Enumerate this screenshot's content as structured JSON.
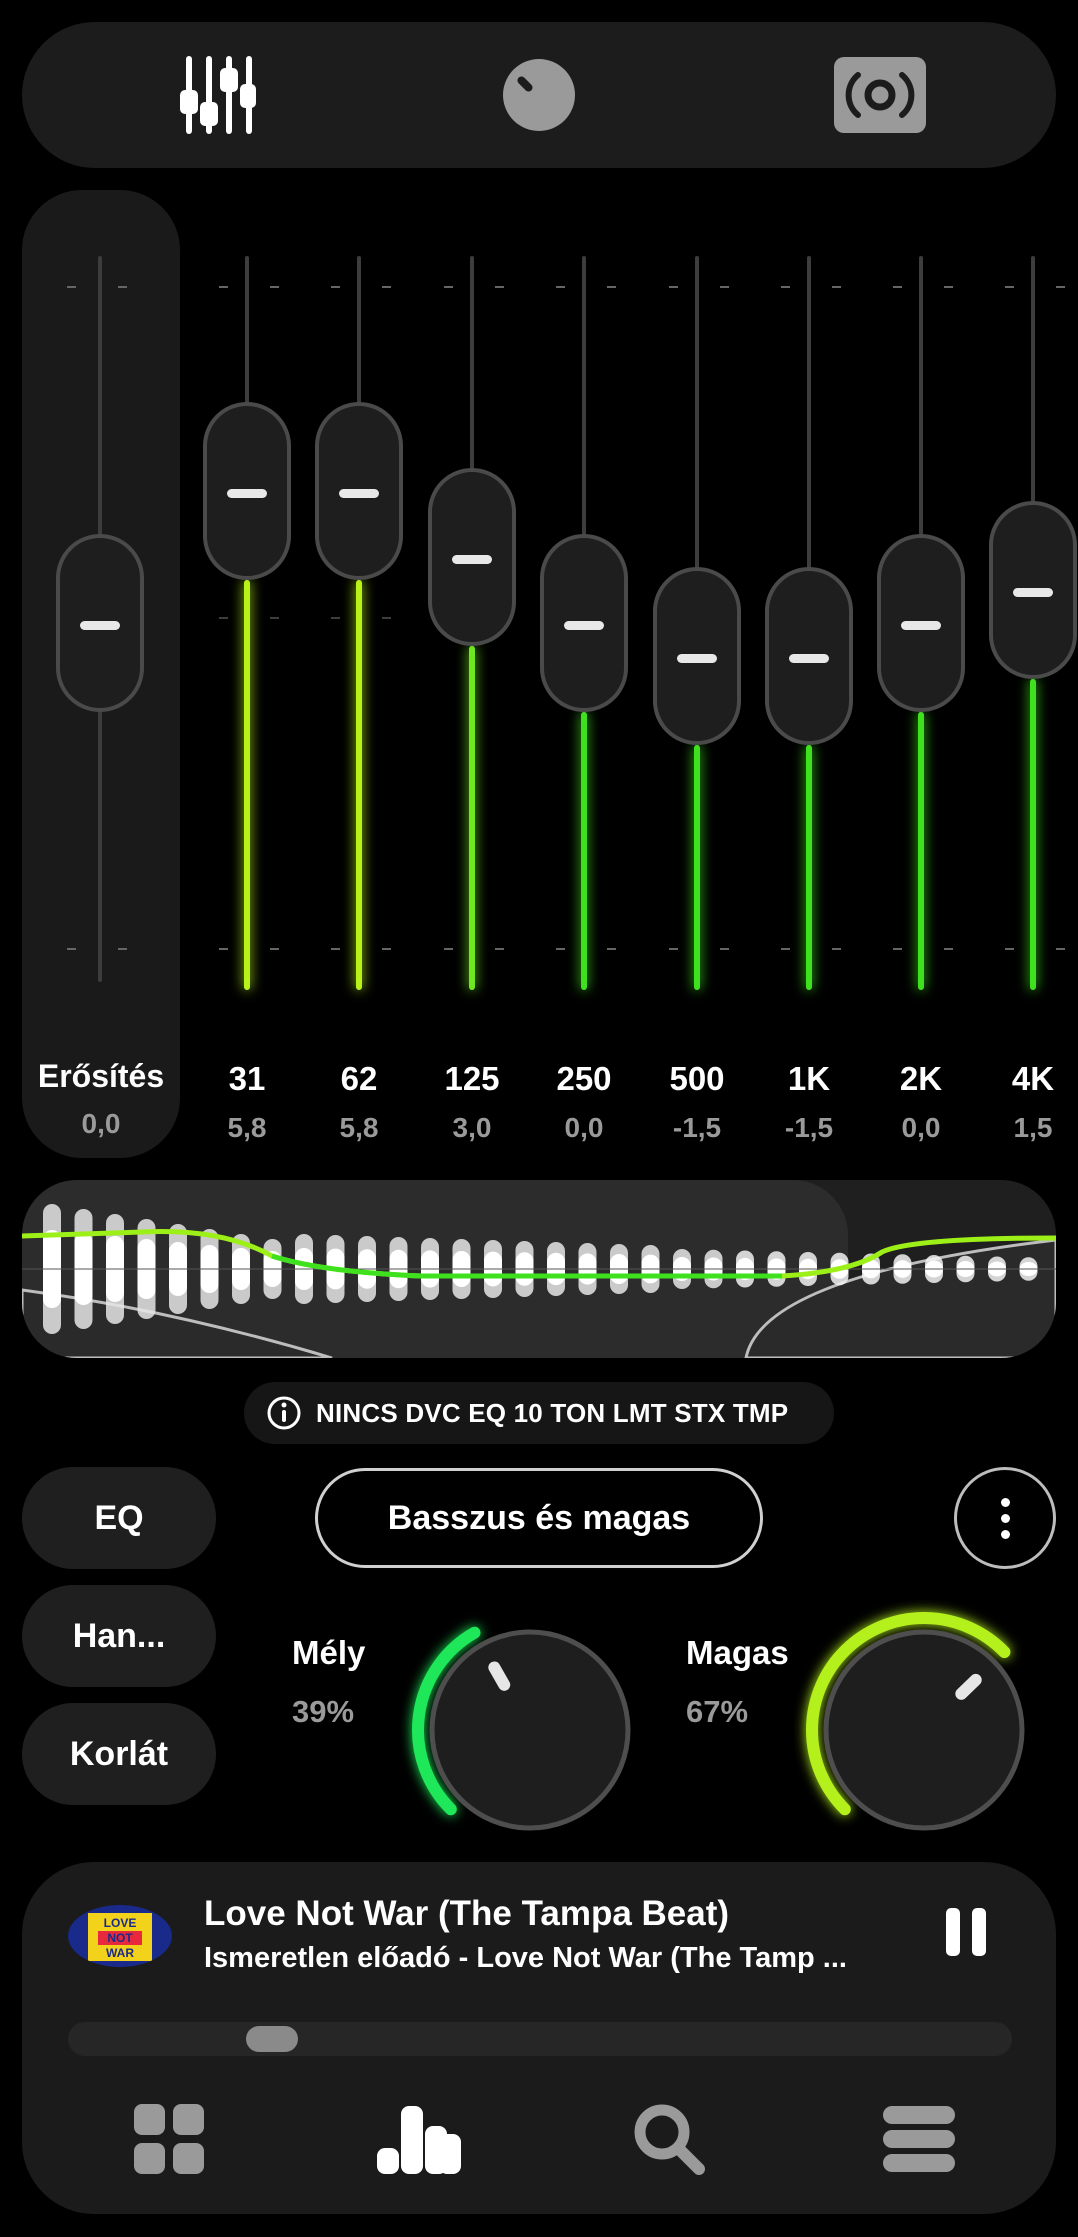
{
  "top_tabs": [
    {
      "name": "equalizer-tab",
      "icon": "equalizer-sliders-icon",
      "active": true
    },
    {
      "name": "volume-tab",
      "icon": "volume-knob-icon",
      "active": false
    },
    {
      "name": "speaker-tab",
      "icon": "speaker-icon",
      "active": false
    }
  ],
  "gain": {
    "label": "Erősítés",
    "value": "0,0",
    "level": 0.5
  },
  "bands": [
    {
      "freq": "31",
      "value": "5,8",
      "level": 0.68,
      "color": "#b8f218"
    },
    {
      "freq": "62",
      "value": "5,8",
      "level": 0.68,
      "color": "#b8f218"
    },
    {
      "freq": "125",
      "value": "3,0",
      "level": 0.59,
      "color": "#6fe820"
    },
    {
      "freq": "250",
      "value": "0,0",
      "level": 0.5,
      "color": "#3fe01e"
    },
    {
      "freq": "500",
      "value": "-1,5",
      "level": 0.455,
      "color": "#3fe01e"
    },
    {
      "freq": "1K",
      "value": "-1,5",
      "level": 0.455,
      "color": "#3fe01e"
    },
    {
      "freq": "2K",
      "value": "0,0",
      "level": 0.5,
      "color": "#3fe01e"
    },
    {
      "freq": "4K",
      "value": "1,5",
      "level": 0.545,
      "color": "#3fe01e"
    }
  ],
  "info_pill": {
    "icon": "info-icon",
    "text": "NINCS DVC EQ 10 TON LMT STX TMP"
  },
  "side_buttons": [
    "EQ",
    "Han...",
    "Korlát"
  ],
  "preset_button": "Basszus és magas",
  "bass": {
    "label": "Mély",
    "value": "39%",
    "level": 0.39,
    "color": "#1ee85a"
  },
  "treble": {
    "label": "Magas",
    "value": "67%",
    "level": 0.67,
    "color": "#b4f01c"
  },
  "player": {
    "title": "Love Not War (The Tampa Beat)",
    "subtitle": "Ismeretlen előadó - Love Not War (The Tamp ...",
    "art_text": [
      "LOVE",
      "NOT",
      "WAR"
    ],
    "progress": 0.2
  },
  "bottom_nav": [
    {
      "name": "library-grid",
      "icon": "grid-icon",
      "active": false
    },
    {
      "name": "equalizer",
      "icon": "bar-chart-icon",
      "active": true
    },
    {
      "name": "search",
      "icon": "search-icon",
      "active": false
    },
    {
      "name": "queue",
      "icon": "menu-icon",
      "active": false
    }
  ],
  "colors": {
    "accent_green": "#3fe01e",
    "accent_lime": "#b8f218",
    "background": "#000000"
  }
}
